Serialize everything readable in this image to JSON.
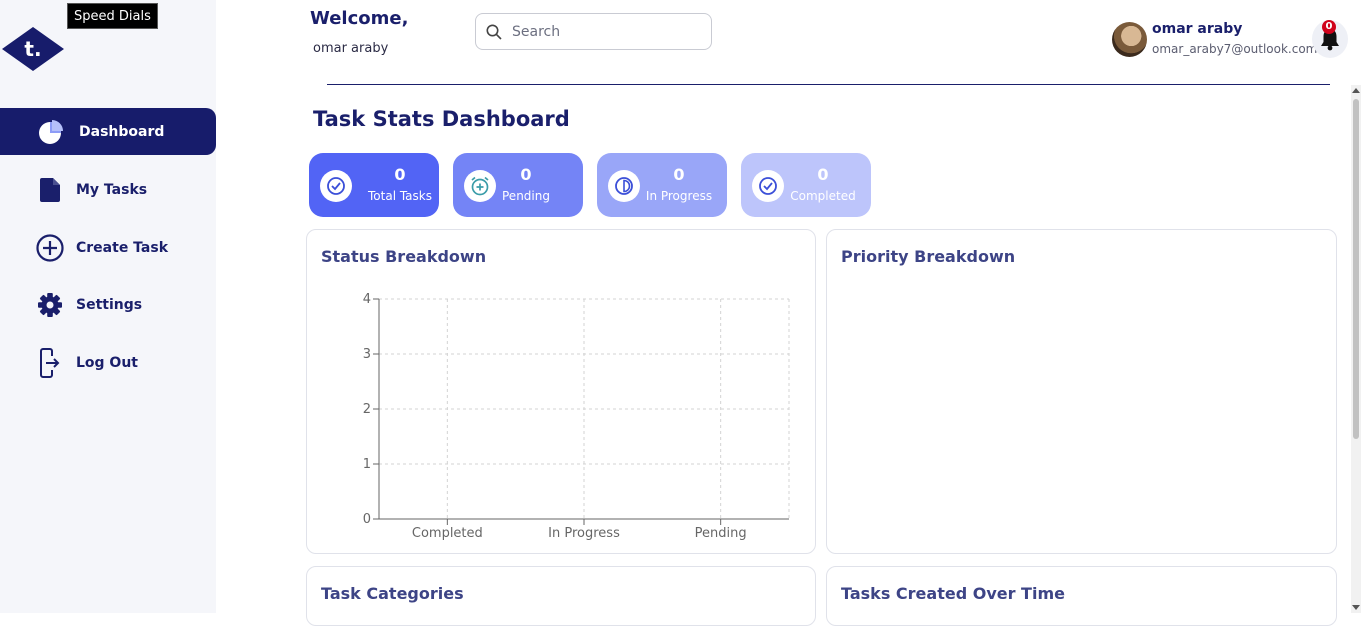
{
  "tooltip": "Speed Dials",
  "logo_letter": "t.",
  "sidebar": {
    "items": [
      {
        "label": "Dashboard",
        "icon": "pie-chart-icon",
        "active": true
      },
      {
        "label": "My Tasks",
        "icon": "document-icon",
        "active": false
      },
      {
        "label": "Create Task",
        "icon": "plus-circle-icon",
        "active": false
      },
      {
        "label": "Settings",
        "icon": "gear-icon",
        "active": false
      },
      {
        "label": "Log Out",
        "icon": "logout-icon",
        "active": false
      }
    ]
  },
  "header": {
    "welcome": "Welcome,",
    "username": "omar araby",
    "search_placeholder": "Search",
    "profile_name": "omar araby",
    "profile_email": "omar_araby7@outlook.com",
    "notification_count": "0"
  },
  "page_title": "Task Stats Dashboard",
  "stats": [
    {
      "value": "0",
      "label": "Total Tasks",
      "color": "#5264f5"
    },
    {
      "value": "0",
      "label": "Pending",
      "color": "#7484f6"
    },
    {
      "value": "0",
      "label": "In Progress",
      "color": "#99a6f8"
    },
    {
      "value": "0",
      "label": "Completed",
      "color": "#bdc5fb"
    }
  ],
  "panels": {
    "status": "Status Breakdown",
    "priority": "Priority Breakdown",
    "categories": "Task Categories",
    "created": "Tasks Created Over Time"
  },
  "chart_data": {
    "type": "bar",
    "title": "Status Breakdown",
    "categories": [
      "Completed",
      "In Progress",
      "Pending"
    ],
    "values": [
      0,
      0,
      0
    ],
    "ylim": [
      0,
      4
    ],
    "yticks": [
      0,
      1,
      2,
      3,
      4
    ],
    "grid": true,
    "xlabel": "",
    "ylabel": ""
  }
}
